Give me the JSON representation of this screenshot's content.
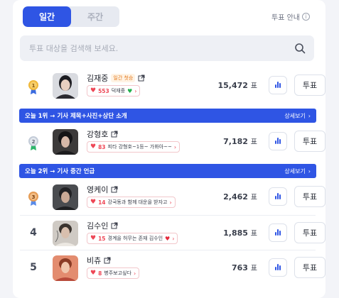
{
  "tabs": [
    {
      "label": "일간",
      "active": true
    },
    {
      "label": "주간",
      "active": false
    }
  ],
  "guide": {
    "label": "투표 안내",
    "icon": "info-icon"
  },
  "search": {
    "placeholder": "투표 대상을 검색해 보세요.",
    "value": "",
    "icon": "search-icon"
  },
  "colors": {
    "accent": "#2f55e4",
    "gold": "#f0b83a",
    "silver": "#a9b3c1",
    "bronze": "#e59b53",
    "heart": "#ee4756"
  },
  "rows": [
    {
      "rank": "1",
      "rank_type": "medal-gold",
      "name": "김재중",
      "tag": "일간 첫승",
      "cheer_count": "553",
      "cheer_text": "덕재중",
      "cheer_emoji": "green-heart",
      "votes": "15,472",
      "unit": "표",
      "vote_label": "투표"
    },
    {
      "rank": "2",
      "rank_type": "medal-silver",
      "name": "강형호",
      "tag": "",
      "cheer_count": "83",
      "cheer_text": "피타 강형호~1등~ 가봐아~~",
      "cheer_emoji": "",
      "votes": "7,182",
      "unit": "표",
      "vote_label": "투표"
    },
    {
      "rank": "3",
      "rank_type": "medal-bronze",
      "name": "영케이",
      "tag": "",
      "cheer_count": "14",
      "cheer_text": "강국동과 함께 대운을 받자고",
      "cheer_emoji": "",
      "votes": "2,462",
      "unit": "표",
      "vote_label": "투표"
    },
    {
      "rank": "4",
      "rank_type": "number",
      "name": "김수인",
      "tag": "",
      "cheer_count": "15",
      "cheer_text": "경계을 허무는 존재 김수인",
      "cheer_emoji": "red-heart",
      "votes": "1,885",
      "unit": "표",
      "vote_label": "투표"
    },
    {
      "rank": "5",
      "rank_type": "number",
      "name": "비츄",
      "tag": "",
      "cheer_count": "8",
      "cheer_text": "병주보고싶다",
      "cheer_emoji": "",
      "votes": "763",
      "unit": "표",
      "vote_label": "투표"
    }
  ],
  "banners": [
    {
      "text": "오늘 1위 → 기사 제목+사진+상단 소개",
      "more": "상세보기"
    },
    {
      "text": "오늘 2위 → 기사 중간 언급",
      "more": "상세보기"
    }
  ]
}
